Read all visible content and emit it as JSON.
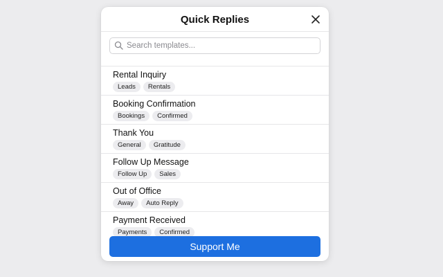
{
  "modal": {
    "title": "Quick Replies",
    "close_icon": "close-icon"
  },
  "search": {
    "placeholder": "Search templates...",
    "value": "",
    "icon": "search-icon"
  },
  "templates": [
    {
      "name": "Rental Inquiry",
      "tags": [
        "Leads",
        "Rentals"
      ]
    },
    {
      "name": "Booking Confirmation",
      "tags": [
        "Bookings",
        "Confirmed"
      ]
    },
    {
      "name": "Thank You",
      "tags": [
        "General",
        "Gratitude"
      ]
    },
    {
      "name": "Follow Up Message",
      "tags": [
        "Follow Up",
        "Sales"
      ]
    },
    {
      "name": "Out of Office",
      "tags": [
        "Away",
        "Auto Reply"
      ]
    },
    {
      "name": "Payment Received",
      "tags": [
        "Payments",
        "Confirmed"
      ]
    }
  ],
  "footer": {
    "support_label": "Support Me"
  },
  "colors": {
    "accent": "#1d6fe0",
    "background": "#ececee",
    "tag_bg": "#ececef"
  }
}
